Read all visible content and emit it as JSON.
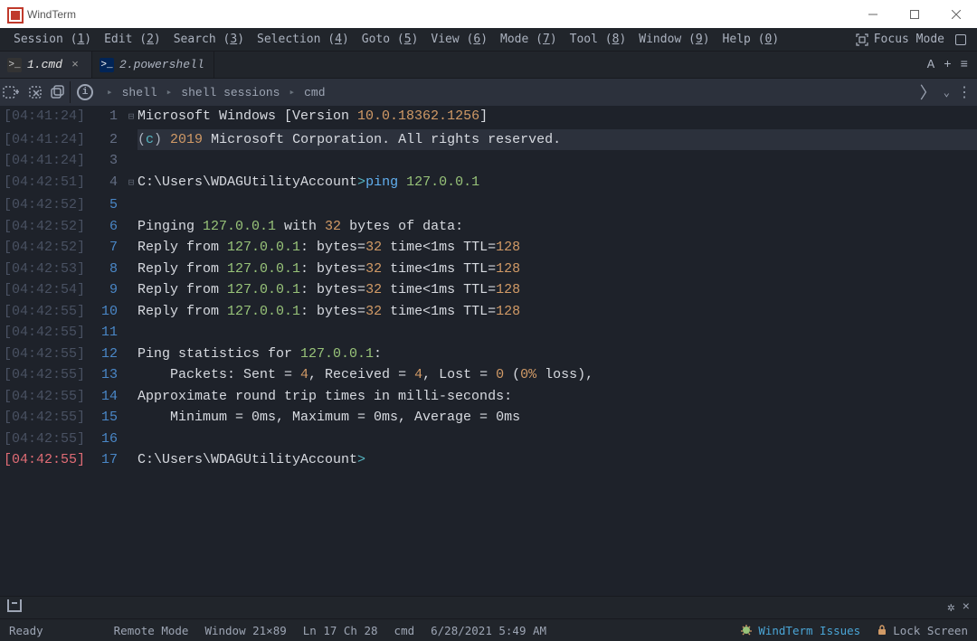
{
  "title": "WindTerm",
  "menu": [
    "Session (1)",
    "Edit (2)",
    "Search (3)",
    "Selection (4)",
    "Goto (5)",
    "View (6)",
    "Mode (7)",
    "Tool (8)",
    "Window (9)",
    "Help (0)"
  ],
  "focus_mode_label": "Focus Mode",
  "tabs": [
    {
      "label": "1.cmd",
      "icon": "cmd"
    },
    {
      "label": "2.powershell",
      "icon": "ps"
    }
  ],
  "tab_action_a": "A",
  "tab_action_plus": "+",
  "tab_action_menu": "≡",
  "breadcrumbs": [
    "shell",
    "shell sessions",
    "cmd"
  ],
  "lines": [
    {
      "ts": "[04:41:24]",
      "n": "1",
      "gut": "⊟",
      "segs": [
        {
          "t": "Microsoft Windows [Version "
        },
        {
          "t": "10.0.18362.1256",
          "c": "ver"
        },
        {
          "t": "]"
        }
      ]
    },
    {
      "ts": "[04:41:24]",
      "n": "2",
      "hl": true,
      "segs": [
        {
          "t": "(",
          "c": "gray"
        },
        {
          "t": "c",
          "c": "copy"
        },
        {
          "t": ") ",
          "c": "gray"
        },
        {
          "t": "2019",
          "c": "year"
        },
        {
          "t": " Microsoft Corporation. All rights reserved."
        }
      ]
    },
    {
      "ts": "[04:41:24]",
      "n": "3",
      "segs": [
        {
          "t": ""
        }
      ]
    },
    {
      "ts": "[04:42:51]",
      "n": "4",
      "gut": "⊟",
      "segs": [
        {
          "t": "C:\\Users\\WDAGUtilityAccount",
          "c": "path"
        },
        {
          "t": ">",
          "c": "sym"
        },
        {
          "t": "ping ",
          "c": "cmd"
        },
        {
          "t": "127.0.0.1",
          "c": "ip"
        }
      ]
    },
    {
      "ts": "[04:42:52]",
      "n": "5",
      "segs": [
        {
          "t": ""
        }
      ]
    },
    {
      "ts": "[04:42:52]",
      "n": "6",
      "segs": [
        {
          "t": "Pinging "
        },
        {
          "t": "127.0.0.1",
          "c": "ip"
        },
        {
          "t": " with "
        },
        {
          "t": "32",
          "c": "num"
        },
        {
          "t": " bytes of data:"
        }
      ]
    },
    {
      "ts": "[04:42:52]",
      "n": "7",
      "segs": [
        {
          "t": "Reply from "
        },
        {
          "t": "127.0.0.1",
          "c": "ip"
        },
        {
          "t": ": bytes="
        },
        {
          "t": "32",
          "c": "num"
        },
        {
          "t": " time<1ms TTL="
        },
        {
          "t": "128",
          "c": "num"
        }
      ]
    },
    {
      "ts": "[04:42:53]",
      "n": "8",
      "segs": [
        {
          "t": "Reply from "
        },
        {
          "t": "127.0.0.1",
          "c": "ip"
        },
        {
          "t": ": bytes="
        },
        {
          "t": "32",
          "c": "num"
        },
        {
          "t": " time<1ms TTL="
        },
        {
          "t": "128",
          "c": "num"
        }
      ]
    },
    {
      "ts": "[04:42:54]",
      "n": "9",
      "segs": [
        {
          "t": "Reply from "
        },
        {
          "t": "127.0.0.1",
          "c": "ip"
        },
        {
          "t": ": bytes="
        },
        {
          "t": "32",
          "c": "num"
        },
        {
          "t": " time<1ms TTL="
        },
        {
          "t": "128",
          "c": "num"
        }
      ]
    },
    {
      "ts": "[04:42:55]",
      "n": "10",
      "segs": [
        {
          "t": "Reply from "
        },
        {
          "t": "127.0.0.1",
          "c": "ip"
        },
        {
          "t": ": bytes="
        },
        {
          "t": "32",
          "c": "num"
        },
        {
          "t": " time<1ms TTL="
        },
        {
          "t": "128",
          "c": "num"
        }
      ]
    },
    {
      "ts": "[04:42:55]",
      "n": "11",
      "segs": [
        {
          "t": ""
        }
      ]
    },
    {
      "ts": "[04:42:55]",
      "n": "12",
      "segs": [
        {
          "t": "Ping statistics for "
        },
        {
          "t": "127.0.0.1",
          "c": "ip"
        },
        {
          "t": ":"
        }
      ]
    },
    {
      "ts": "[04:42:55]",
      "n": "13",
      "segs": [
        {
          "t": "    Packets: Sent = "
        },
        {
          "t": "4",
          "c": "num"
        },
        {
          "t": ", Received = "
        },
        {
          "t": "4",
          "c": "num"
        },
        {
          "t": ", Lost = "
        },
        {
          "t": "0",
          "c": "num"
        },
        {
          "t": " ("
        },
        {
          "t": "0%",
          "c": "num"
        },
        {
          "t": " loss),"
        }
      ]
    },
    {
      "ts": "[04:42:55]",
      "n": "14",
      "segs": [
        {
          "t": "Approximate round trip times in milli-seconds:"
        }
      ]
    },
    {
      "ts": "[04:42:55]",
      "n": "15",
      "segs": [
        {
          "t": "    Minimum = 0ms, Maximum = 0ms, Average = 0ms"
        }
      ]
    },
    {
      "ts": "[04:42:55]",
      "n": "16",
      "segs": [
        {
          "t": ""
        }
      ]
    },
    {
      "ts": "[04:42:55]",
      "n": "17",
      "current": true,
      "segs": [
        {
          "t": "C:\\Users\\WDAGUtilityAccount",
          "c": "path"
        },
        {
          "t": ">",
          "c": "sym"
        }
      ]
    }
  ],
  "status": {
    "ready": "Ready",
    "remote": "Remote Mode",
    "window": "Window 21×89",
    "pos": "Ln 17 Ch 28",
    "mode": "cmd",
    "datetime": "6/28/2021 5:49 AM",
    "issues": "WindTerm Issues",
    "lock": "Lock Screen"
  }
}
